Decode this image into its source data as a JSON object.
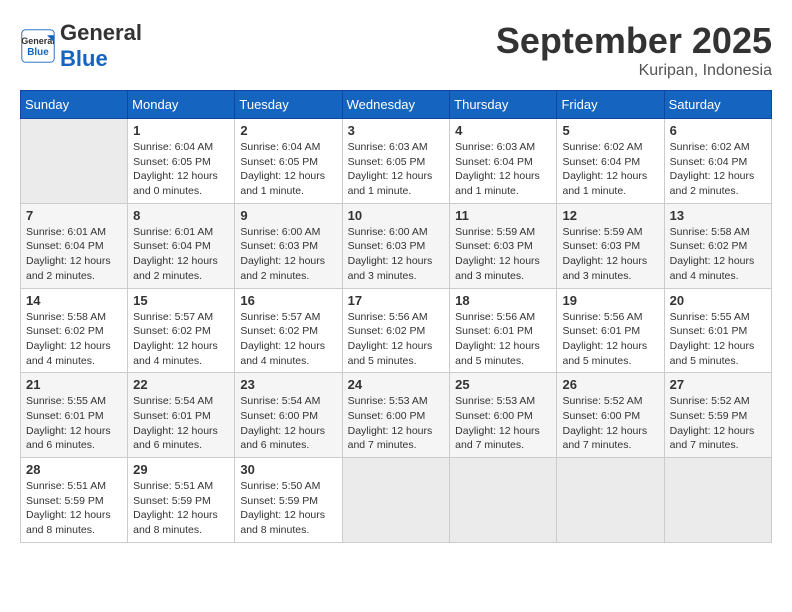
{
  "header": {
    "logo_general": "General",
    "logo_blue": "Blue",
    "month_title": "September 2025",
    "location": "Kuripan, Indonesia"
  },
  "days_of_week": [
    "Sunday",
    "Monday",
    "Tuesday",
    "Wednesday",
    "Thursday",
    "Friday",
    "Saturday"
  ],
  "weeks": [
    [
      {
        "day": "",
        "info": ""
      },
      {
        "day": "1",
        "info": "Sunrise: 6:04 AM\nSunset: 6:05 PM\nDaylight: 12 hours\nand 0 minutes."
      },
      {
        "day": "2",
        "info": "Sunrise: 6:04 AM\nSunset: 6:05 PM\nDaylight: 12 hours\nand 1 minute."
      },
      {
        "day": "3",
        "info": "Sunrise: 6:03 AM\nSunset: 6:05 PM\nDaylight: 12 hours\nand 1 minute."
      },
      {
        "day": "4",
        "info": "Sunrise: 6:03 AM\nSunset: 6:04 PM\nDaylight: 12 hours\nand 1 minute."
      },
      {
        "day": "5",
        "info": "Sunrise: 6:02 AM\nSunset: 6:04 PM\nDaylight: 12 hours\nand 1 minute."
      },
      {
        "day": "6",
        "info": "Sunrise: 6:02 AM\nSunset: 6:04 PM\nDaylight: 12 hours\nand 2 minutes."
      }
    ],
    [
      {
        "day": "7",
        "info": "Sunrise: 6:01 AM\nSunset: 6:04 PM\nDaylight: 12 hours\nand 2 minutes."
      },
      {
        "day": "8",
        "info": "Sunrise: 6:01 AM\nSunset: 6:04 PM\nDaylight: 12 hours\nand 2 minutes."
      },
      {
        "day": "9",
        "info": "Sunrise: 6:00 AM\nSunset: 6:03 PM\nDaylight: 12 hours\nand 2 minutes."
      },
      {
        "day": "10",
        "info": "Sunrise: 6:00 AM\nSunset: 6:03 PM\nDaylight: 12 hours\nand 3 minutes."
      },
      {
        "day": "11",
        "info": "Sunrise: 5:59 AM\nSunset: 6:03 PM\nDaylight: 12 hours\nand 3 minutes."
      },
      {
        "day": "12",
        "info": "Sunrise: 5:59 AM\nSunset: 6:03 PM\nDaylight: 12 hours\nand 3 minutes."
      },
      {
        "day": "13",
        "info": "Sunrise: 5:58 AM\nSunset: 6:02 PM\nDaylight: 12 hours\nand 4 minutes."
      }
    ],
    [
      {
        "day": "14",
        "info": "Sunrise: 5:58 AM\nSunset: 6:02 PM\nDaylight: 12 hours\nand 4 minutes."
      },
      {
        "day": "15",
        "info": "Sunrise: 5:57 AM\nSunset: 6:02 PM\nDaylight: 12 hours\nand 4 minutes."
      },
      {
        "day": "16",
        "info": "Sunrise: 5:57 AM\nSunset: 6:02 PM\nDaylight: 12 hours\nand 4 minutes."
      },
      {
        "day": "17",
        "info": "Sunrise: 5:56 AM\nSunset: 6:02 PM\nDaylight: 12 hours\nand 5 minutes."
      },
      {
        "day": "18",
        "info": "Sunrise: 5:56 AM\nSunset: 6:01 PM\nDaylight: 12 hours\nand 5 minutes."
      },
      {
        "day": "19",
        "info": "Sunrise: 5:56 AM\nSunset: 6:01 PM\nDaylight: 12 hours\nand 5 minutes."
      },
      {
        "day": "20",
        "info": "Sunrise: 5:55 AM\nSunset: 6:01 PM\nDaylight: 12 hours\nand 5 minutes."
      }
    ],
    [
      {
        "day": "21",
        "info": "Sunrise: 5:55 AM\nSunset: 6:01 PM\nDaylight: 12 hours\nand 6 minutes."
      },
      {
        "day": "22",
        "info": "Sunrise: 5:54 AM\nSunset: 6:01 PM\nDaylight: 12 hours\nand 6 minutes."
      },
      {
        "day": "23",
        "info": "Sunrise: 5:54 AM\nSunset: 6:00 PM\nDaylight: 12 hours\nand 6 minutes."
      },
      {
        "day": "24",
        "info": "Sunrise: 5:53 AM\nSunset: 6:00 PM\nDaylight: 12 hours\nand 7 minutes."
      },
      {
        "day": "25",
        "info": "Sunrise: 5:53 AM\nSunset: 6:00 PM\nDaylight: 12 hours\nand 7 minutes."
      },
      {
        "day": "26",
        "info": "Sunrise: 5:52 AM\nSunset: 6:00 PM\nDaylight: 12 hours\nand 7 minutes."
      },
      {
        "day": "27",
        "info": "Sunrise: 5:52 AM\nSunset: 5:59 PM\nDaylight: 12 hours\nand 7 minutes."
      }
    ],
    [
      {
        "day": "28",
        "info": "Sunrise: 5:51 AM\nSunset: 5:59 PM\nDaylight: 12 hours\nand 8 minutes."
      },
      {
        "day": "29",
        "info": "Sunrise: 5:51 AM\nSunset: 5:59 PM\nDaylight: 12 hours\nand 8 minutes."
      },
      {
        "day": "30",
        "info": "Sunrise: 5:50 AM\nSunset: 5:59 PM\nDaylight: 12 hours\nand 8 minutes."
      },
      {
        "day": "",
        "info": ""
      },
      {
        "day": "",
        "info": ""
      },
      {
        "day": "",
        "info": ""
      },
      {
        "day": "",
        "info": ""
      }
    ]
  ]
}
